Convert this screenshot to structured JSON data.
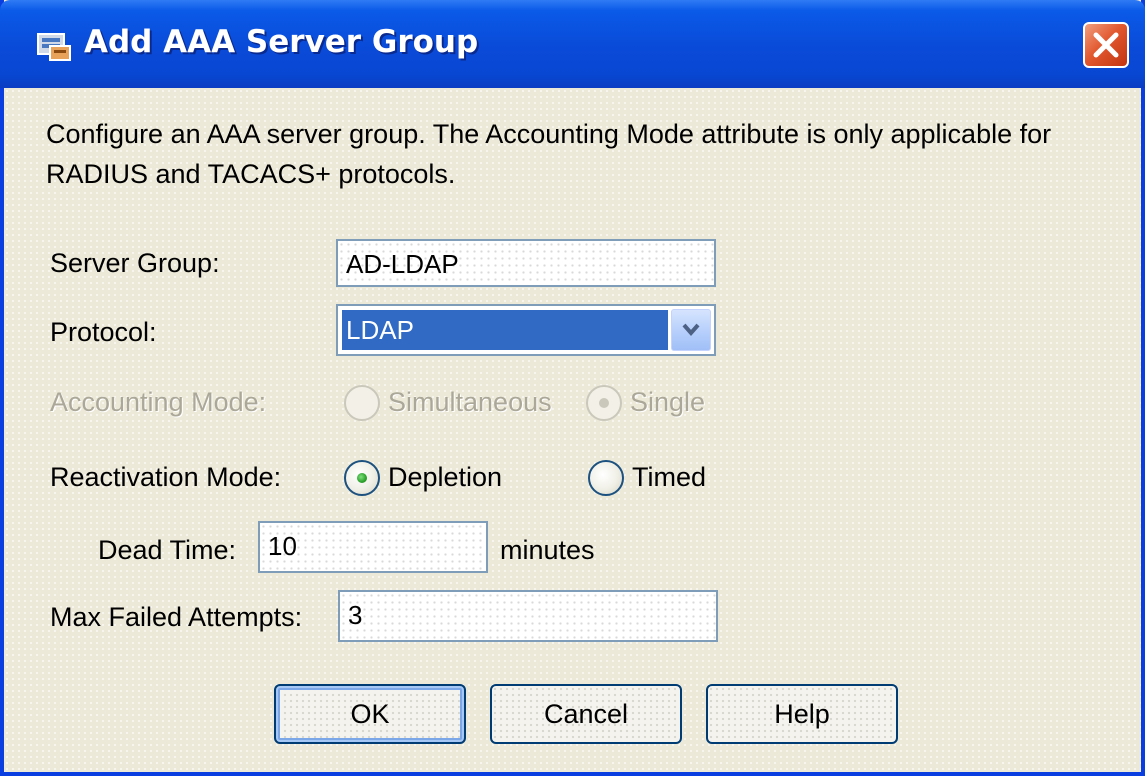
{
  "window": {
    "title": "Add AAA Server Group",
    "icons": {
      "app": "aaa-server-icon",
      "close": "close-icon"
    },
    "colors": {
      "titlebar": "#0a4ad8",
      "close_button": "#e2582f",
      "selection": "#316ac5"
    }
  },
  "description": "Configure an AAA server group. The Accounting Mode attribute is only applicable for RADIUS and TACACS+ protocols.",
  "form": {
    "server_group": {
      "label": "Server Group:",
      "value": "AD-LDAP"
    },
    "protocol": {
      "label": "Protocol:",
      "value": "LDAP",
      "icon": "chevron-down-icon"
    },
    "accounting_mode": {
      "label": "Accounting Mode:",
      "enabled": false,
      "options": [
        {
          "label": "Simultaneous",
          "selected": false
        },
        {
          "label": "Single",
          "selected": true
        }
      ]
    },
    "reactivation_mode": {
      "label": "Reactivation Mode:",
      "options": [
        {
          "label": "Depletion",
          "selected": true
        },
        {
          "label": "Timed",
          "selected": false
        }
      ]
    },
    "dead_time": {
      "label": "Dead Time:",
      "value": "10",
      "unit": "minutes"
    },
    "max_failed_attempts": {
      "label": "Max Failed Attempts:",
      "value": "3"
    }
  },
  "buttons": {
    "ok": "OK",
    "cancel": "Cancel",
    "help": "Help"
  }
}
